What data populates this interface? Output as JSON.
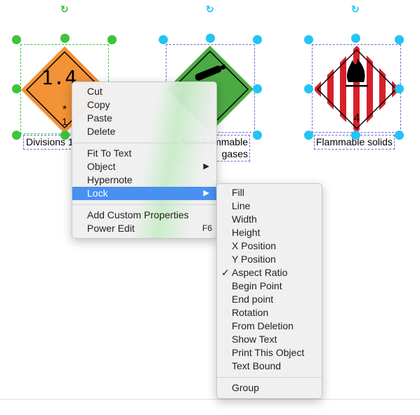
{
  "shapes": [
    {
      "label": "Divisions 1.4",
      "number": "1.4",
      "sub_star": "*",
      "sub_num": "1",
      "color": "#f39237"
    },
    {
      "label_line1": "Non-flammable",
      "label_line2": "gases",
      "color": "#4caa44"
    },
    {
      "label": "Flammable solids",
      "number": "4",
      "color": "#d8202a"
    }
  ],
  "context_menu": {
    "items": [
      "Cut",
      "Copy",
      "Paste",
      "Delete",
      "Fit To Text",
      "Object",
      "Hypernote",
      "Lock",
      "Add Custom Properties",
      "Power Edit"
    ],
    "power_edit_shortcut": "F6",
    "highlighted": "Lock"
  },
  "lock_submenu": {
    "items": [
      "Fill",
      "Line",
      "Width",
      "Height",
      "X Position",
      "Y Position",
      "Aspect Ratio",
      "Begin Point",
      "End point",
      "Rotation",
      "From Deletion",
      "Show Text",
      "Print This Object",
      "Text Bound",
      "Group"
    ],
    "checked": "Aspect Ratio",
    "check_glyph": "✓"
  },
  "colors": {
    "selection_primary": "#3cc43c",
    "selection_secondary": "#22c4f4",
    "highlight": "#4a90f0"
  }
}
